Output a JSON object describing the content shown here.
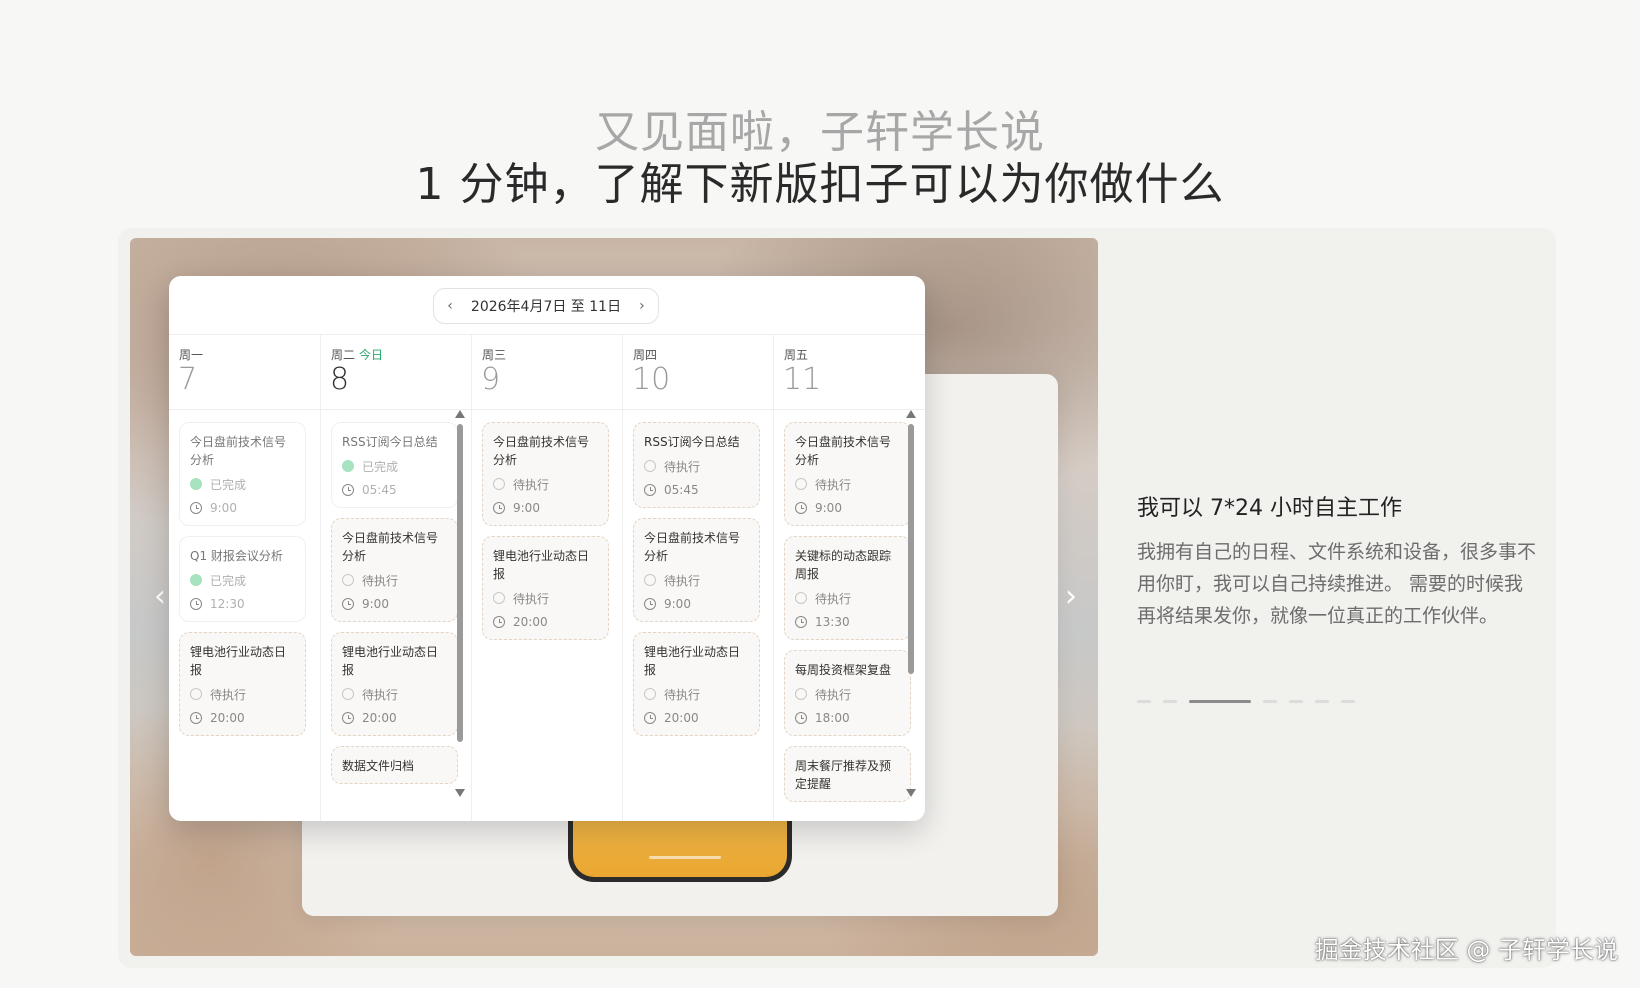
{
  "hero": {
    "line1": "又见面啦，子轩学长说",
    "line2": "1 分钟，了解下新版扣子可以为你做什么"
  },
  "calendar": {
    "range_label": "2026年4月7日 至 11日",
    "days": [
      {
        "name": "周一",
        "today_label": "",
        "date": "7",
        "tasks": [
          {
            "title": "今日盘前技术信号分析",
            "status": "已完成",
            "time": "9:00",
            "done": true
          },
          {
            "title": "Q1 财报会议分析",
            "status": "已完成",
            "time": "12:30",
            "done": true
          },
          {
            "title": "锂电池行业动态日报",
            "status": "待执行",
            "time": "20:00",
            "done": false
          }
        ]
      },
      {
        "name": "周二",
        "today_label": "今日",
        "date": "8",
        "tasks": [
          {
            "title": "RSS订阅今日总结",
            "status": "已完成",
            "time": "05:45",
            "done": true
          },
          {
            "title": "今日盘前技术信号分析",
            "status": "待执行",
            "time": "9:00",
            "done": false
          },
          {
            "title": "锂电池行业动态日报",
            "status": "待执行",
            "time": "20:00",
            "done": false
          },
          {
            "title": "数据文件归档",
            "status": "",
            "time": "",
            "done": false
          }
        ]
      },
      {
        "name": "周三",
        "today_label": "",
        "date": "9",
        "tasks": [
          {
            "title": "今日盘前技术信号分析",
            "status": "待执行",
            "time": "9:00",
            "done": false
          },
          {
            "title": "锂电池行业动态日报",
            "status": "待执行",
            "time": "20:00",
            "done": false
          }
        ]
      },
      {
        "name": "周四",
        "today_label": "",
        "date": "10",
        "tasks": [
          {
            "title": "RSS订阅今日总结",
            "status": "待执行",
            "time": "05:45",
            "done": false
          },
          {
            "title": "今日盘前技术信号分析",
            "status": "待执行",
            "time": "9:00",
            "done": false
          },
          {
            "title": "锂电池行业动态日报",
            "status": "待执行",
            "time": "20:00",
            "done": false
          }
        ]
      },
      {
        "name": "周五",
        "today_label": "",
        "date": "11",
        "tasks": [
          {
            "title": "今日盘前技术信号分析",
            "status": "待执行",
            "time": "9:00",
            "done": false
          },
          {
            "title": "关键标的动态跟踪周报",
            "status": "待执行",
            "time": "13:30",
            "done": false
          },
          {
            "title": "每周投资框架复盘",
            "status": "待执行",
            "time": "18:00",
            "done": false
          },
          {
            "title": "周末餐厅推荐及预定提醒",
            "status": "",
            "time": "",
            "done": false
          }
        ]
      }
    ],
    "scroll_position": 0.0
  },
  "feature": {
    "title": "我可以 7*24 小时自主工作",
    "body": "我拥有自己的日程、文件系统和设备，很多事不用你盯，我可以自己持续推进。 需要的时候我再将结果发你，就像一位真正的工作伙伴。"
  },
  "pagination": {
    "total": 7,
    "active_index": 2
  },
  "nav": {
    "prev_glyph": "‹",
    "next_glyph": "›"
  },
  "watermark": "掘金技术社区 @ 子轩学长说",
  "colors": {
    "today_accent": "#28a96a",
    "done_dot": "#a6e3c0",
    "phone_accent": "#f0b23e"
  }
}
